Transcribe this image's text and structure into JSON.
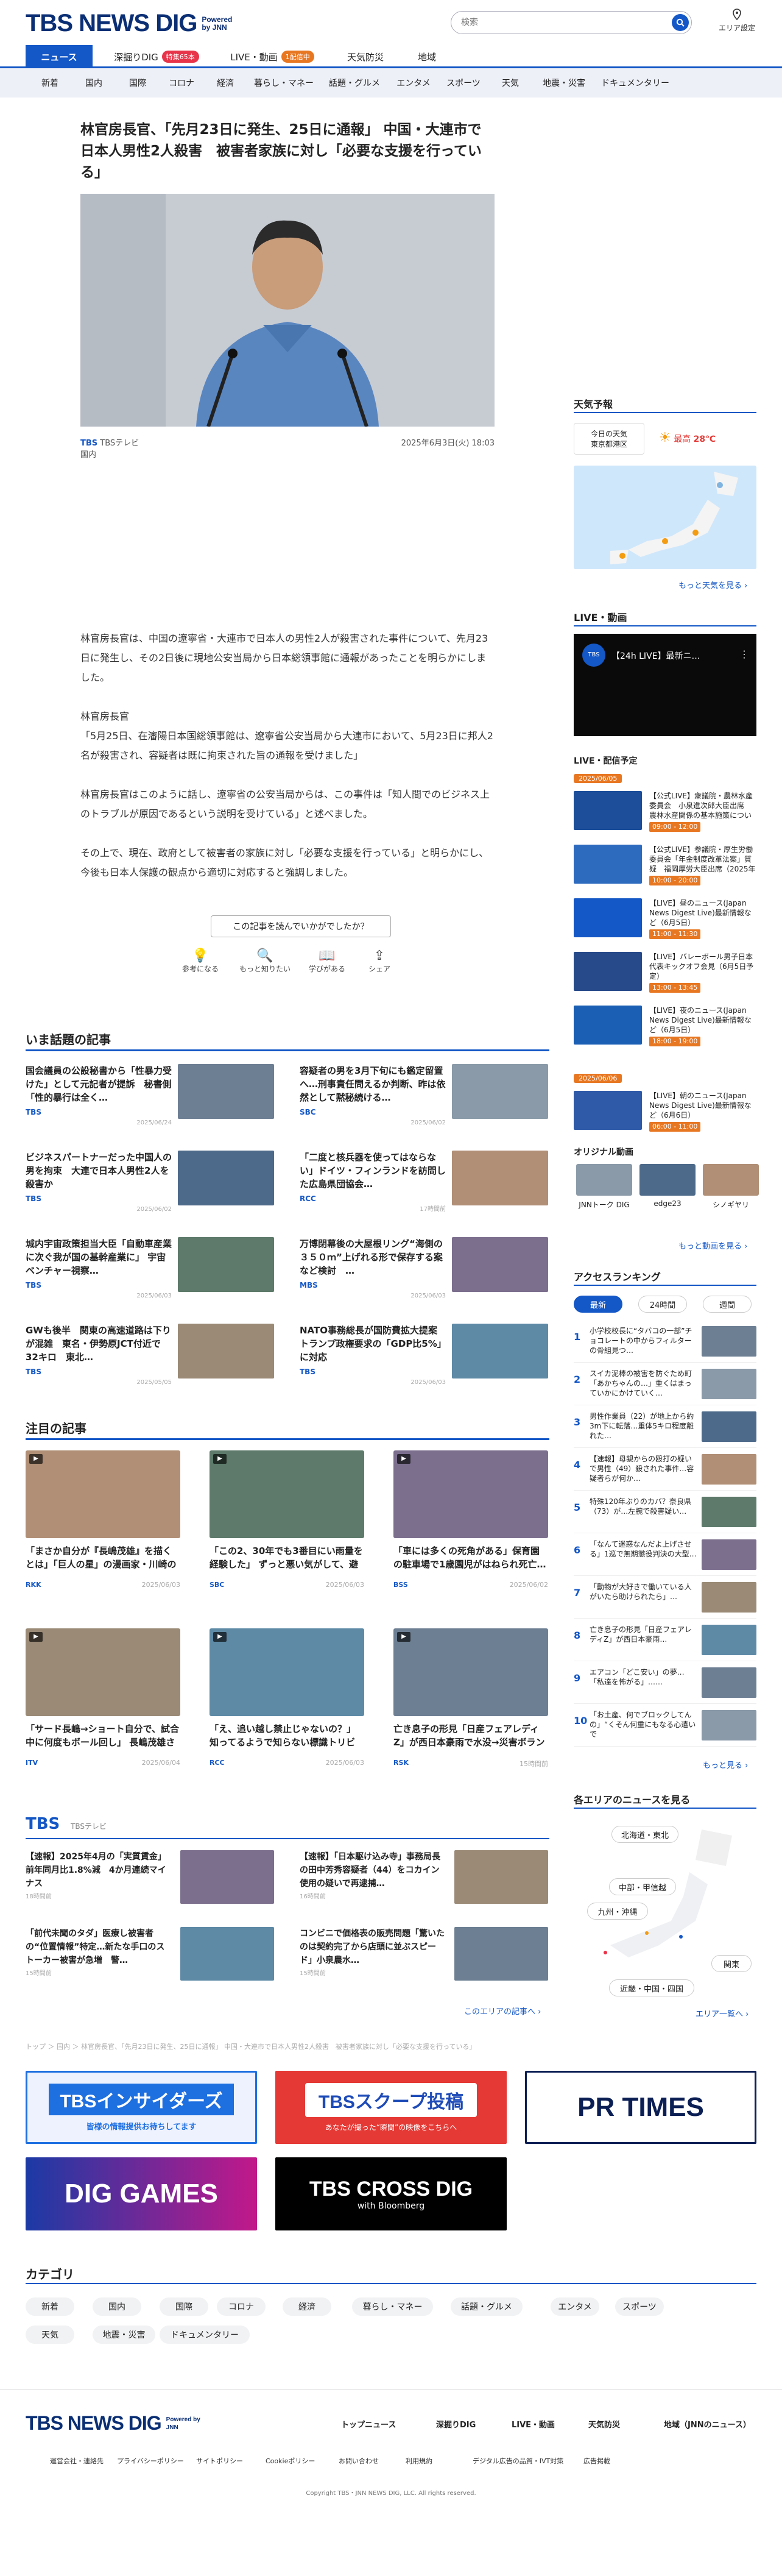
{
  "header": {
    "logo": "TBS NEWS DIG",
    "powered": "Powered by JNN",
    "search_placeholder": "検索",
    "area_label": "エリア設定"
  },
  "tabs": [
    {
      "label": "ニュース"
    },
    {
      "label": "深掘りDIG",
      "badge": "特集65本"
    },
    {
      "label": "LIVE・動画",
      "badge": "1配信中"
    },
    {
      "label": "天気防災"
    },
    {
      "label": "地域"
    }
  ],
  "categories": [
    "新着",
    "国内",
    "国際",
    "コロナ",
    "経済",
    "暮らし・マネー",
    "話題・グルメ",
    "エンタメ",
    "スポーツ",
    "天気",
    "地震・災害",
    "ドキュメンタリー"
  ],
  "article": {
    "title": "林官房長官、「先月23日に発生、25日に通報」 中国・大連市で日本人男性2人殺害　被害者家族に対し「必要な支援を行っている」",
    "source_logo": "TBS",
    "source": "TBSテレビ",
    "date": "2025年6月3日(火) 18:03",
    "category": "国内",
    "paragraphs": [
      "林官房長官は、中国の遼寧省・大連市で日本人の男性2人が殺害された事件について、先月23日に発生し、その2日後に現地公安当局から日本総領事館に通報があったことを明らかにしました。",
      "林官房長官\n「5月25日、在瀋陽日本国総領事館は、遼寧省公安当局から大連市において、5月23日に邦人2名が殺害され、容疑者は既に拘束された旨の通報を受けました」",
      "林官房長官はこのように話し、遼寧省の公安当局からは、この事件は「知人間でのビジネス上のトラブルが原因であるという説明を受けている」と述べました。",
      "その上で、現在、政府として被害者の家族に対し「必要な支援を行っている」と明らかにし、今後も日本人保護の観点から適切に対応すると強調しました。"
    ],
    "question": "この記事を読んでいかがでしたか？",
    "reactions": [
      "参考になる",
      "もっと知りたい",
      "学びがある",
      "シェア"
    ]
  },
  "hot": {
    "title": "いま話題の記事",
    "items": [
      {
        "title": "国会議員の公設秘書から「性暴力受けた」として元記者が提訴　秘書側「性的暴行は全く…",
        "src": "TBS",
        "date": "2025/06/24"
      },
      {
        "title": "容疑者の男を3月下旬にも鑑定留置へ…刑事責任問えるか判断、昨は依然として黙秘続ける…",
        "src": "SBC",
        "date": "2025/06/02"
      },
      {
        "title": "ビジネスパートナーだった中国人の男を拘束　大連で日本人男性2人を殺害か",
        "src": "TBS",
        "date": "2025/06/02"
      },
      {
        "title": "「二度と核兵器を使ってはならない」ドイツ・フィンランドを訪問した広島県団協会…",
        "src": "RCC",
        "date": "17時間前"
      },
      {
        "title": "城内宇宙政策担当大臣「自動車産業に次ぐ我が国の基幹産業に」 宇宙ベンチャー視察…",
        "src": "TBS",
        "date": "2025/06/03"
      },
      {
        "title": "万博閉幕後の大屋根リング“海側の３５０ｍ”上げれる形で保存する案など検討　…",
        "src": "MBS",
        "date": "2025/06/03"
      },
      {
        "title": "GWも後半　関東の高速道路は下りが混雑　東名・伊勢原JCT付近で32キロ　東北…",
        "src": "TBS",
        "date": "2025/05/05"
      },
      {
        "title": "NATO事務総長が国防費拡大提案　トランプ政権要求の「GDP比5%」に対応",
        "src": "TBS",
        "date": "2025/06/03"
      }
    ]
  },
  "featured": {
    "title": "注目の記事",
    "items": [
      {
        "title": "「まさか自分が『長嶋茂雄』を描くとは」「巨人の星」の漫画家・川崎のぼるさんによる“スーパースタ…",
        "src": "RKK",
        "date": "2025/06/03"
      },
      {
        "title": "「この2、30年でも3番目にい雨量を経験した」 ずっと悪い気がして、避けていた天気が…気温…",
        "src": "SBC",
        "date": "2025/06/03"
      },
      {
        "title": "「車には多くの死角がある」保育園の駐車場で1歳園児がはねられ死亡…運転手から気づかない、70代…",
        "src": "BSS",
        "date": "2025/06/02"
      },
      {
        "title": "「サード長嶋→ショート自分で、試合中に何度もボール回し」 長嶋茂雄さんが特別な存在として…",
        "src": "ITV",
        "date": "2025/06/04"
      },
      {
        "title": "「え、追い越し禁止じゃないの？」知ってるようで知らない標識トリビア…「ゾーン30」って何？警察に…",
        "src": "RCC",
        "date": "2025/06/03"
      },
      {
        "title": "亡き息子の形見「日産フェアレディZ」が西日本豪雨で水没→災害ボランティアの学生たちが修復",
        "src": "RSK",
        "date": "15時間前"
      }
    ]
  },
  "tbs_block": {
    "title": "TBS",
    "sub": "TBSテレビ",
    "more": "このエリアの記事へ",
    "items": [
      {
        "title": "【速報】2025年4月の「実質賃金」前年同月比1.8%減　4か月連続マイナス",
        "date": "18時間前"
      },
      {
        "title": "【速報】「日本駆け込み寺」事務局長の田中芳秀容疑者（44）をコカイン使用の疑いで再逮捕…",
        "date": "16時間前"
      },
      {
        "title": "「前代未聞のタダ」医療し被害者の“位置情報”特定…新たな手口のストーカー被害が急増　警…",
        "date": "15時間前"
      },
      {
        "title": "コンビニで価格表の販売問題「驚いたのは契約完了から店頭に並ぶスピード」小泉農水…",
        "date": "15時間前"
      }
    ]
  },
  "breadcrumb": "トップ ＞ 国内 ＞ 林官房長官、「先月23日に発生、25日に通報」 中国・大連市で日本人男性2人殺害　被害者家族に対し「必要な支援を行っている」",
  "banners": [
    {
      "main": "TBSインサイダーズ",
      "sub": "皆様の情報提供お待ちしてます"
    },
    {
      "main": "TBSスクープ投稿",
      "sub": "あなたが撮った“瞬間”の映像をこちらへ"
    },
    {
      "main": "PR TIMES",
      "sub": ""
    },
    {
      "main": "DIG GAMES",
      "sub": ""
    },
    {
      "main": "TBS CROSS DIG",
      "sub": "with Bloomberg"
    }
  ],
  "sidebar": {
    "weather": {
      "title": "天気予報",
      "today": "今日の天気",
      "region": "東京都港区",
      "label": "最高",
      "temp": "28℃",
      "more": "もっと天気を見る"
    },
    "live": {
      "title": "LIVE・動画",
      "video_title": "【24h LIVE】最新ニ…",
      "schedule": "LIVE・配信予定",
      "date1": "2025/06/05",
      "date2": "2025/06/06",
      "more": "もっと動画を見る",
      "items": [
        {
          "title": "【公式LIVE】衆議院・農林水産委員会　小泉進次郎大臣出席　農林水産関係の基本施策について質疑（2025年6月5日）",
          "time": "09:00 - 12:00"
        },
        {
          "title": "【公式LIVE】参議院・厚生労働委員会「年金制度改革法案」質疑　福岡厚労大臣出席（2025年6月5日）",
          "time": "10:00 - 20:00"
        },
        {
          "title": "【LIVE】昼のニュース(Japan News Digest Live)最新情報など（6月5日）",
          "time": "11:00 - 11:30"
        },
        {
          "title": "【LIVE】バレーボール男子日本代表キックオフ会見（6月5日予定）",
          "time": "13:00 - 13:45"
        },
        {
          "title": "【LIVE】夜のニュース(Japan News Digest Live)最新情報など（6月5日）",
          "time": "18:00 - 19:00"
        },
        {
          "title": "【LIVE】朝のニュース(Japan News Digest Live)最新情報など（6月6日）",
          "time": "06:00 - 11:00"
        }
      ],
      "original": "オリジナル動画",
      "orig_items": [
        "JNNトーク DIG",
        "edge23",
        "シノギヤリ"
      ]
    },
    "ranking": {
      "title": "アクセスランキング",
      "tabs": [
        "最新",
        "24時間",
        "週間"
      ],
      "more": "もっと見る",
      "items": [
        "小学校校長に“タバコの一部”チョコレートの中からフィルターの骨組見つ…",
        "スイカ泥棒の被害を防ぐため町「あかちゃんの…」重くはまっていかにかけていく…",
        "男性作業員（22）が地上から約3m下に転落…重体5キロ程度離れた…",
        "【速報】母親からの殴打の疑いで男性（49）殺された事件…容疑者らが何か…",
        "特殊120年ぶりのカバ？奈良県（73）が…左腕で殺害疑い…",
        "「なんて迷惑なんだよ上げさせる」1巡で無期懲役判決の大型…",
        "「動物が大好きで働いている人がいたら助けられたら」…",
        "亡き息子の形見「日産フェアレディZ」が西日本豪雨…",
        "エアコン「どこ安い」の夢…「私達を怖がる」……",
        "「お土産、何でブロックしてんの」“くそん何重にもなる心遣いで"
      ]
    },
    "regions": {
      "title": "各エリアのニュースを見る",
      "items": [
        "北海道・東北",
        "中部・甲信越",
        "九州・沖縄",
        "関東",
        "近畿・中国・四国"
      ],
      "more": "エリア一覧へ"
    }
  },
  "footer": {
    "cat_title": "カテゴリ",
    "cats": [
      "新着",
      "国内",
      "国際",
      "コロナ",
      "経済",
      "暮らし・マネー",
      "話題・グルメ",
      "エンタメ",
      "スポーツ",
      "天気",
      "地震・災害",
      "ドキュメンタリー"
    ],
    "links_main": [
      "トップニュース",
      "深掘りDIG",
      "LIVE・動画",
      "天気防災",
      "地域（JNNのニュース）"
    ],
    "links_sub": [
      "運営会社・連絡先",
      "プライバシーポリシー",
      "サイトポリシー",
      "Cookieポリシー",
      "お問い合わせ",
      "利用規約",
      "デジタル広告の品質・IVT対策",
      "広告掲載"
    ],
    "copyright": "Copyright TBS・JNN NEWS DIG, LLC. All rights reserved."
  },
  "colors": {
    "brand": "#0b2f74",
    "accent": "#1457c6",
    "orange": "#e87722"
  }
}
